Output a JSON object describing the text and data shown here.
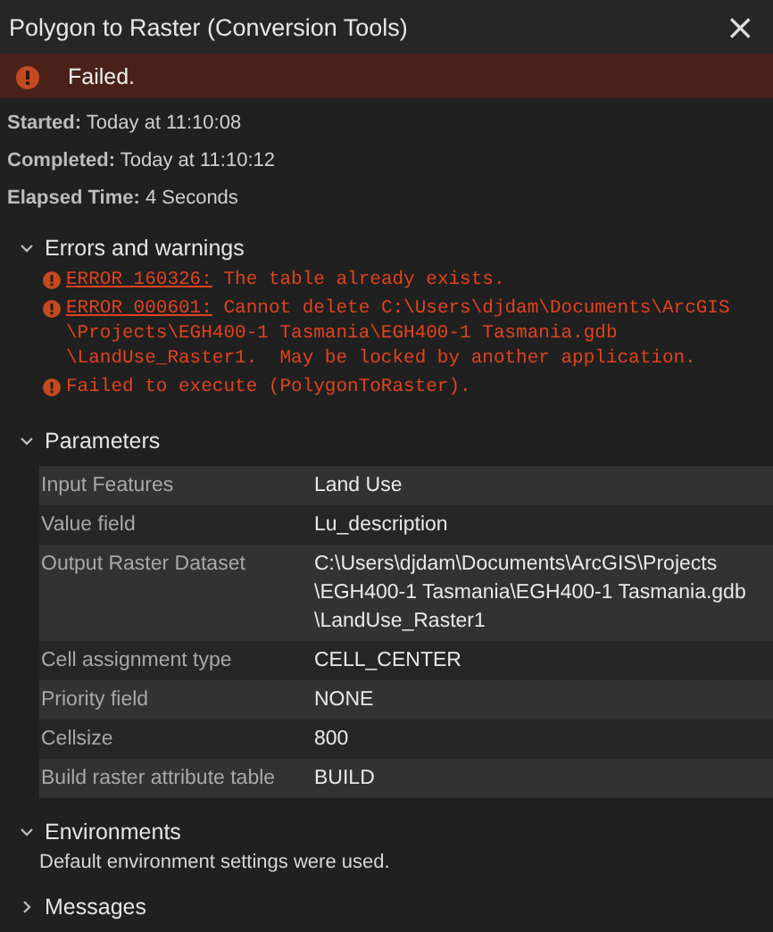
{
  "window": {
    "title": "Polygon to Raster (Conversion Tools)",
    "close": "×"
  },
  "status": {
    "text": "Failed.",
    "kind": "error"
  },
  "summary": [
    {
      "label": "Started:",
      "value": "Today at 11:10:08"
    },
    {
      "label": "Completed:",
      "value": "Today at 11:10:12"
    },
    {
      "label": "Elapsed Time:",
      "value": "4 Seconds"
    }
  ],
  "errors_section": {
    "title": "Errors and warnings",
    "expanded": true,
    "messages": [
      {
        "code": "ERROR 160326:",
        "lines": [
          "The table already exists."
        ]
      },
      {
        "code": "ERROR 000601:",
        "lines": [
          "Cannot delete C:\\Users\\djdam\\Documents\\ArcGIS",
          "\\Projects\\EGH400-1 Tasmania\\EGH400-1 Tasmania.gdb",
          "\\LandUse_Raster1.  May be locked by another application."
        ]
      },
      {
        "lines": [
          "Failed to execute (PolygonToRaster)."
        ]
      }
    ]
  },
  "parameters_section": {
    "title": "Parameters",
    "expanded": true,
    "rows": [
      {
        "label": "Input Features",
        "value": [
          "Land Use"
        ]
      },
      {
        "label": "Value field",
        "value": [
          "Lu_description"
        ]
      },
      {
        "label": "Output Raster Dataset",
        "value": [
          "C:\\Users\\djdam\\Documents\\ArcGIS\\Projects",
          "\\EGH400-1 Tasmania\\EGH400-1 Tasmania.gdb",
          "\\LandUse_Raster1"
        ]
      },
      {
        "label": "Cell assignment type",
        "value": [
          "CELL_CENTER"
        ]
      },
      {
        "label": "Priority field",
        "value": [
          "NONE"
        ]
      },
      {
        "label": "Cellsize",
        "value": [
          "800"
        ]
      },
      {
        "label": "Build raster attribute table",
        "value": [
          "BUILD"
        ]
      }
    ]
  },
  "environments_section": {
    "title": "Environments",
    "expanded": true,
    "text": "Default environment settings were used."
  },
  "messages_section": {
    "title": "Messages",
    "expanded": false
  }
}
